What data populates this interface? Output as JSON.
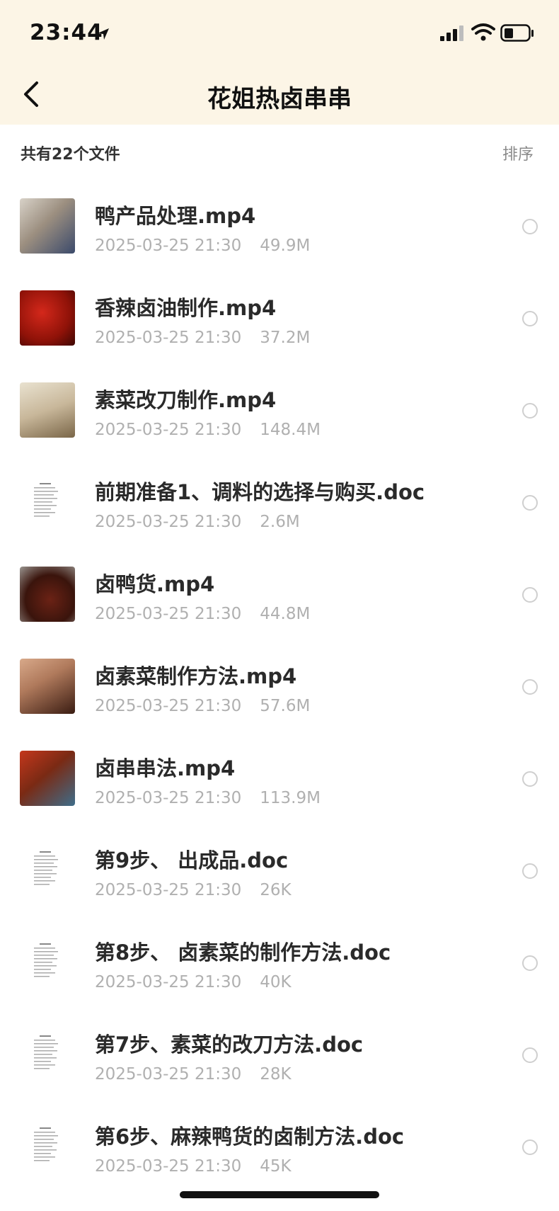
{
  "status_bar": {
    "time": "23:44",
    "icons": [
      "location-arrow-icon",
      "cellular-signal-icon",
      "wifi-icon",
      "battery-icon"
    ]
  },
  "nav": {
    "back_icon": "chevron-left-icon",
    "title": "花姐热卤串串"
  },
  "summary": {
    "count_label": "共有22个文件",
    "sort_label": "排序"
  },
  "files": [
    {
      "name": "鸭产品处理.mp4",
      "date": "2025-03-25 21:30",
      "size": "49.9M",
      "thumb": "video"
    },
    {
      "name": "香辣卤油制作.mp4",
      "date": "2025-03-25 21:30",
      "size": "37.2M",
      "thumb": "video"
    },
    {
      "name": "素菜改刀制作.mp4",
      "date": "2025-03-25 21:30",
      "size": "148.4M",
      "thumb": "video"
    },
    {
      "name": "前期准备1、调料的选择与购买.doc",
      "date": "2025-03-25 21:30",
      "size": "2.6M",
      "thumb": "doc"
    },
    {
      "name": "卤鸭货.mp4",
      "date": "2025-03-25 21:30",
      "size": "44.8M",
      "thumb": "video"
    },
    {
      "name": "卤素菜制作方法.mp4",
      "date": "2025-03-25 21:30",
      "size": "57.6M",
      "thumb": "video"
    },
    {
      "name": "卤串串法.mp4",
      "date": "2025-03-25 21:30",
      "size": "113.9M",
      "thumb": "video"
    },
    {
      "name": "第9步、 出成品.doc",
      "date": "2025-03-25 21:30",
      "size": "26K",
      "thumb": "doc"
    },
    {
      "name": "第8步、 卤素菜的制作方法.doc",
      "date": "2025-03-25 21:30",
      "size": "40K",
      "thumb": "doc"
    },
    {
      "name": "第7步、素菜的改刀方法.doc",
      "date": "2025-03-25 21:30",
      "size": "28K",
      "thumb": "doc"
    },
    {
      "name": "第6步、麻辣鸭货的卤制方法.doc",
      "date": "2025-03-25 21:30",
      "size": "45K",
      "thumb": "doc"
    }
  ],
  "colors": {
    "header_bg": "#fcf5e6",
    "text_primary": "#2a2a2a",
    "text_secondary": "#b0b0b0",
    "radio_border": "#cfcfcf"
  }
}
